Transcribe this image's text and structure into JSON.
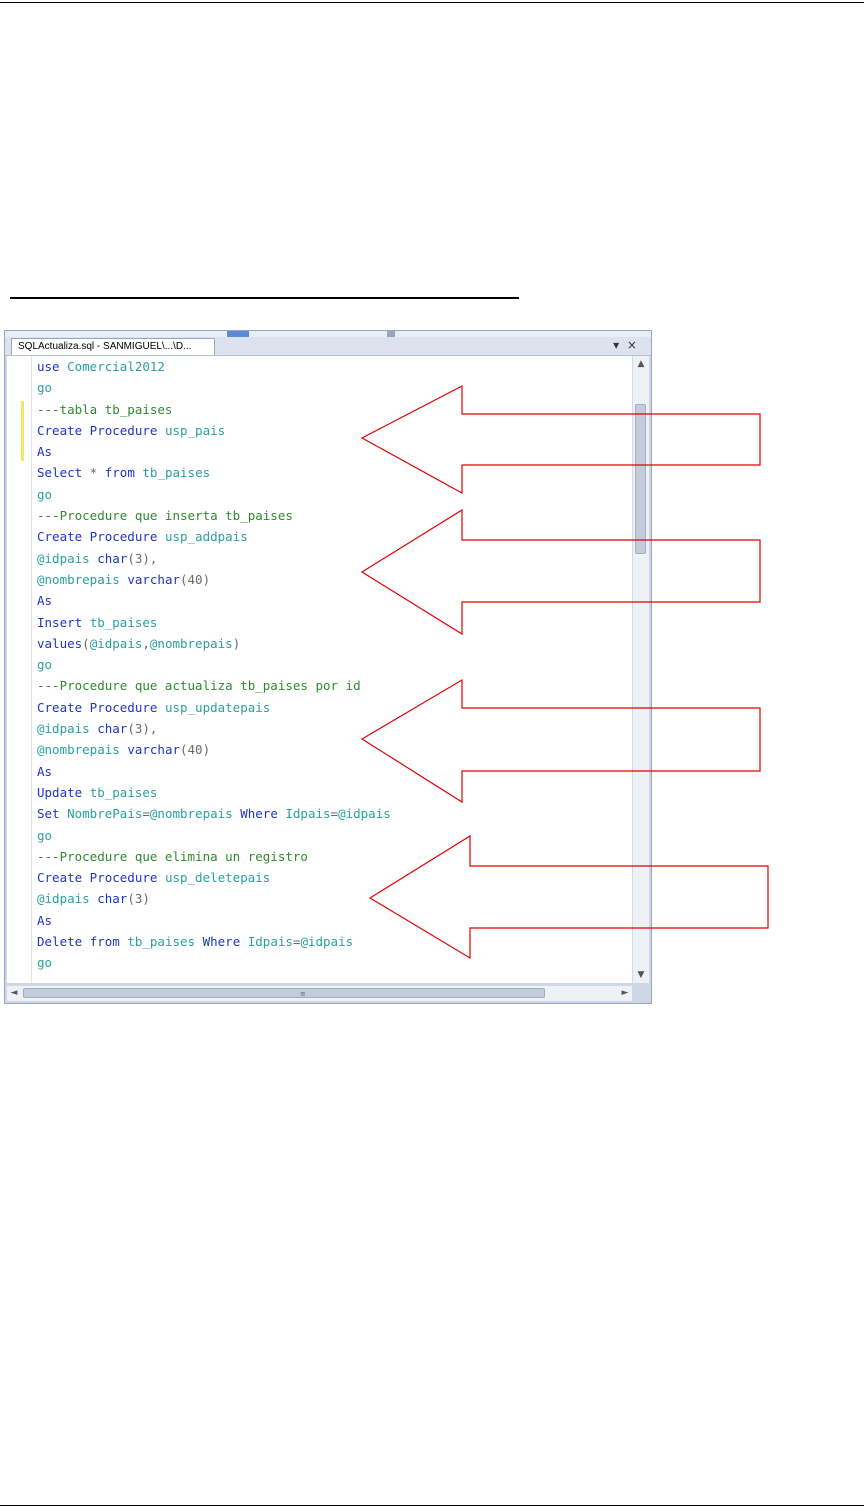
{
  "window": {
    "tab_label": "SQLActualiza.sql - SANMIGUEL\\...\\D...",
    "controls": "▾ ×"
  },
  "code_lines": [
    [
      {
        "t": "use ",
        "c": "kw"
      },
      {
        "t": "Comercial2012",
        "c": "id"
      }
    ],
    [
      {
        "t": "go",
        "c": "id"
      }
    ],
    [
      {
        "t": "---tabla tb_paises",
        "c": "cm"
      }
    ],
    [
      {
        "t": "Create Procedure ",
        "c": "kw"
      },
      {
        "t": "usp_pais",
        "c": "id"
      }
    ],
    [
      {
        "t": "As",
        "c": "kw"
      }
    ],
    [
      {
        "t": "Select ",
        "c": "kw"
      },
      {
        "t": "* ",
        "c": "gr"
      },
      {
        "t": "from ",
        "c": "kw"
      },
      {
        "t": "tb_paises",
        "c": "id"
      }
    ],
    [
      {
        "t": "go",
        "c": "id"
      }
    ],
    [
      {
        "t": "---Procedure que inserta tb_paises",
        "c": "cm"
      }
    ],
    [
      {
        "t": "Create Procedure ",
        "c": "kw"
      },
      {
        "t": "usp_addpais",
        "c": "id"
      }
    ],
    [
      {
        "t": "@idpais ",
        "c": "id"
      },
      {
        "t": "char",
        "c": "kw"
      },
      {
        "t": "(3),",
        "c": "gr"
      }
    ],
    [
      {
        "t": "@nombrepais ",
        "c": "id"
      },
      {
        "t": "varchar",
        "c": "kw"
      },
      {
        "t": "(40)",
        "c": "gr"
      }
    ],
    [
      {
        "t": "As",
        "c": "kw"
      }
    ],
    [
      {
        "t": "Insert ",
        "c": "kw"
      },
      {
        "t": "tb_paises",
        "c": "id"
      }
    ],
    [
      {
        "t": "values",
        "c": "kw"
      },
      {
        "t": "(",
        "c": "gr"
      },
      {
        "t": "@idpais",
        "c": "id"
      },
      {
        "t": ",",
        "c": "gr"
      },
      {
        "t": "@nombrepais",
        "c": "id"
      },
      {
        "t": ")",
        "c": "gr"
      }
    ],
    [
      {
        "t": "go",
        "c": "id"
      }
    ],
    [
      {
        "t": "---Procedure que actualiza tb_paises por id",
        "c": "cm"
      }
    ],
    [
      {
        "t": "Create Procedure ",
        "c": "kw"
      },
      {
        "t": "usp_updatepais",
        "c": "id"
      }
    ],
    [
      {
        "t": "@idpais ",
        "c": "id"
      },
      {
        "t": "char",
        "c": "kw"
      },
      {
        "t": "(3),",
        "c": "gr"
      }
    ],
    [
      {
        "t": "@nombrepais ",
        "c": "id"
      },
      {
        "t": "varchar",
        "c": "kw"
      },
      {
        "t": "(40)",
        "c": "gr"
      }
    ],
    [
      {
        "t": "As",
        "c": "kw"
      }
    ],
    [
      {
        "t": "Update ",
        "c": "kw"
      },
      {
        "t": "tb_paises",
        "c": "id"
      }
    ],
    [
      {
        "t": "Set ",
        "c": "kw"
      },
      {
        "t": "NombrePais",
        "c": "id"
      },
      {
        "t": "=",
        "c": "gr"
      },
      {
        "t": "@nombrepais ",
        "c": "id"
      },
      {
        "t": "Where ",
        "c": "kw"
      },
      {
        "t": "Idpais",
        "c": "id"
      },
      {
        "t": "=",
        "c": "gr"
      },
      {
        "t": "@idpais",
        "c": "id"
      }
    ],
    [
      {
        "t": "go",
        "c": "id"
      }
    ],
    [
      {
        "t": "---Procedure que elimina un registro",
        "c": "cm"
      }
    ],
    [
      {
        "t": "Create Procedure ",
        "c": "kw"
      },
      {
        "t": "usp_deletepais",
        "c": "id"
      }
    ],
    [
      {
        "t": "@idpais ",
        "c": "id"
      },
      {
        "t": "char",
        "c": "kw"
      },
      {
        "t": "(3)",
        "c": "gr"
      }
    ],
    [
      {
        "t": "As",
        "c": "kw"
      }
    ],
    [
      {
        "t": "Delete ",
        "c": "kw"
      },
      {
        "t": "from ",
        "c": "kw"
      },
      {
        "t": "tb_paises ",
        "c": "id"
      },
      {
        "t": "Where ",
        "c": "kw"
      },
      {
        "t": "Idpais",
        "c": "id"
      },
      {
        "t": "=",
        "c": "gr"
      },
      {
        "t": "@idpais",
        "c": "id"
      }
    ],
    [
      {
        "t": "go",
        "c": "id"
      }
    ]
  ],
  "scrollbars": {
    "up": "▲",
    "down": "▼",
    "left": "◄",
    "right": "►",
    "grip": "≡"
  },
  "colors": {
    "keyword": "#1f34c8",
    "comment": "#2f8a2f",
    "identifier": "#2aa0a0",
    "operator": "#6a6a6a",
    "arrow_outline": "#e00000"
  }
}
